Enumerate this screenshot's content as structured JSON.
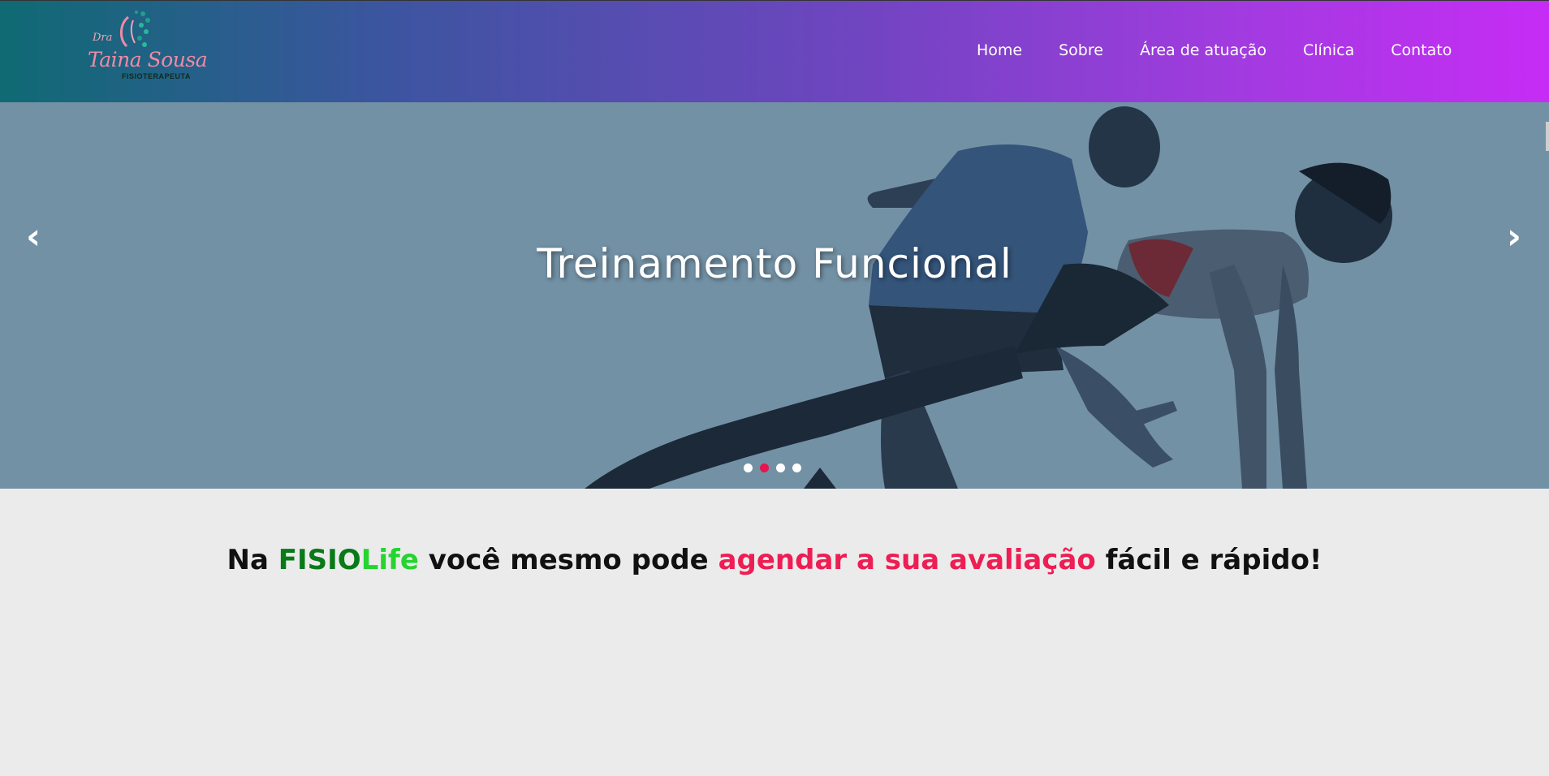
{
  "brand": {
    "prefix": "Dra",
    "name": "Taina Sousa",
    "subtitle": "FISIOTERAPEUTA"
  },
  "nav": {
    "items": [
      {
        "label": "Home"
      },
      {
        "label": "Sobre"
      },
      {
        "label": "Área de atuação"
      },
      {
        "label": "Clínica"
      },
      {
        "label": "Contato"
      }
    ]
  },
  "hero": {
    "title": "Treinamento Funcional",
    "prev_label": "‹",
    "next_label": "›",
    "slides_count": 4,
    "active_slide": 2
  },
  "headline": {
    "part1": "Na ",
    "fisio": "FISIO",
    "life": "Life",
    "part2": " você mesmo pode ",
    "highlight": "agendar a sua avaliação",
    "part3": " fácil e rápido!"
  },
  "colors": {
    "nav_gradient_start": "#0f6a73",
    "nav_gradient_end": "#c62cf5",
    "hero_bg": "#7391a5",
    "accent_pink": "#ee1d53",
    "green": "#0a7a19",
    "lime": "#25d42f"
  }
}
